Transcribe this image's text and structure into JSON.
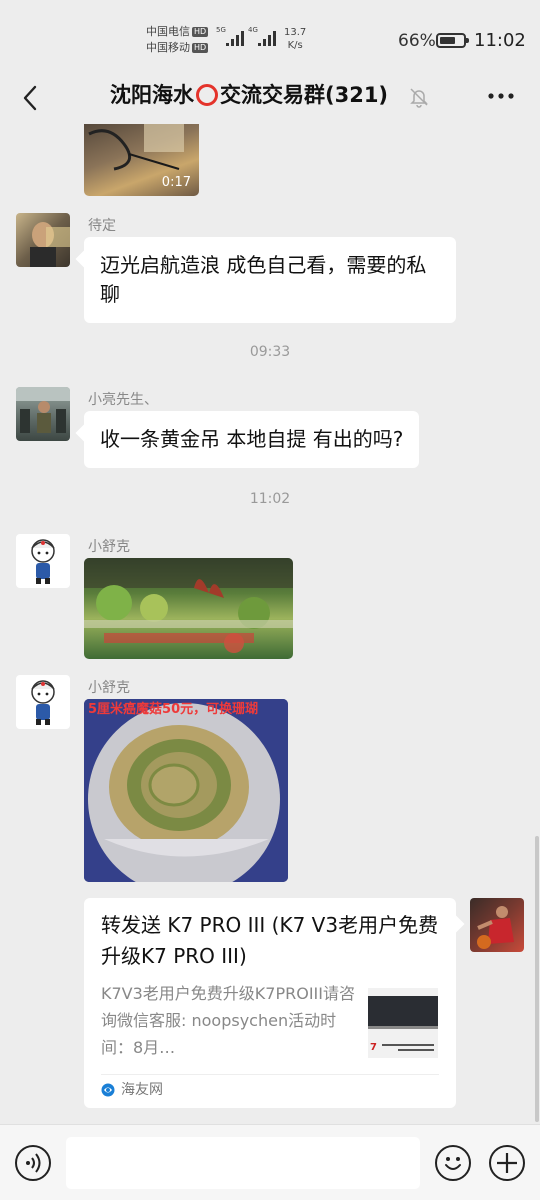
{
  "status_bar": {
    "carrier_1": "中国电信",
    "carrier_2": "中国移动",
    "hd_badge": "HD",
    "signal_1_label": "5G",
    "signal_2_label": "4G",
    "net_speed_value": "13.7",
    "net_speed_unit": "K/s",
    "battery_percent": "66%",
    "battery_level": 0.66,
    "time": "11:02"
  },
  "header": {
    "title_part_1": "沈阳海水",
    "title_part_2": "交流交易群(321)",
    "back_icon": "chevron-left-icon",
    "mute_icon": "bell-off-icon",
    "more_icon": "more-horizontal-icon"
  },
  "messages": [
    {
      "type": "video",
      "duration": "0:17"
    },
    {
      "type": "text",
      "sender": "待定",
      "text": "迈光启航造浪 成色自己看，需要的私聊"
    },
    {
      "type": "timestamp",
      "text": "09:33"
    },
    {
      "type": "text",
      "sender": "小亮先生、",
      "text": "收一条黄金吊 本地自提 有出的吗?"
    },
    {
      "type": "timestamp",
      "text": "11:02"
    },
    {
      "type": "image",
      "sender": "小舒克"
    },
    {
      "type": "image",
      "sender": "小舒克",
      "overlay_text": "5厘米癌魔菇50元，可换珊瑚"
    },
    {
      "type": "link_card",
      "title": "转发送 K7 PRO III (K7 V3老用户免费升级K7 PRO III)",
      "description": "K7V3老用户免费升级K7PROIII请咨询微信客服: noopsychen活动时间：8月…",
      "source": "海友网"
    }
  ],
  "colors": {
    "background": "#ededed",
    "bubble": "#ffffff",
    "accent_red": "#e4332b"
  }
}
